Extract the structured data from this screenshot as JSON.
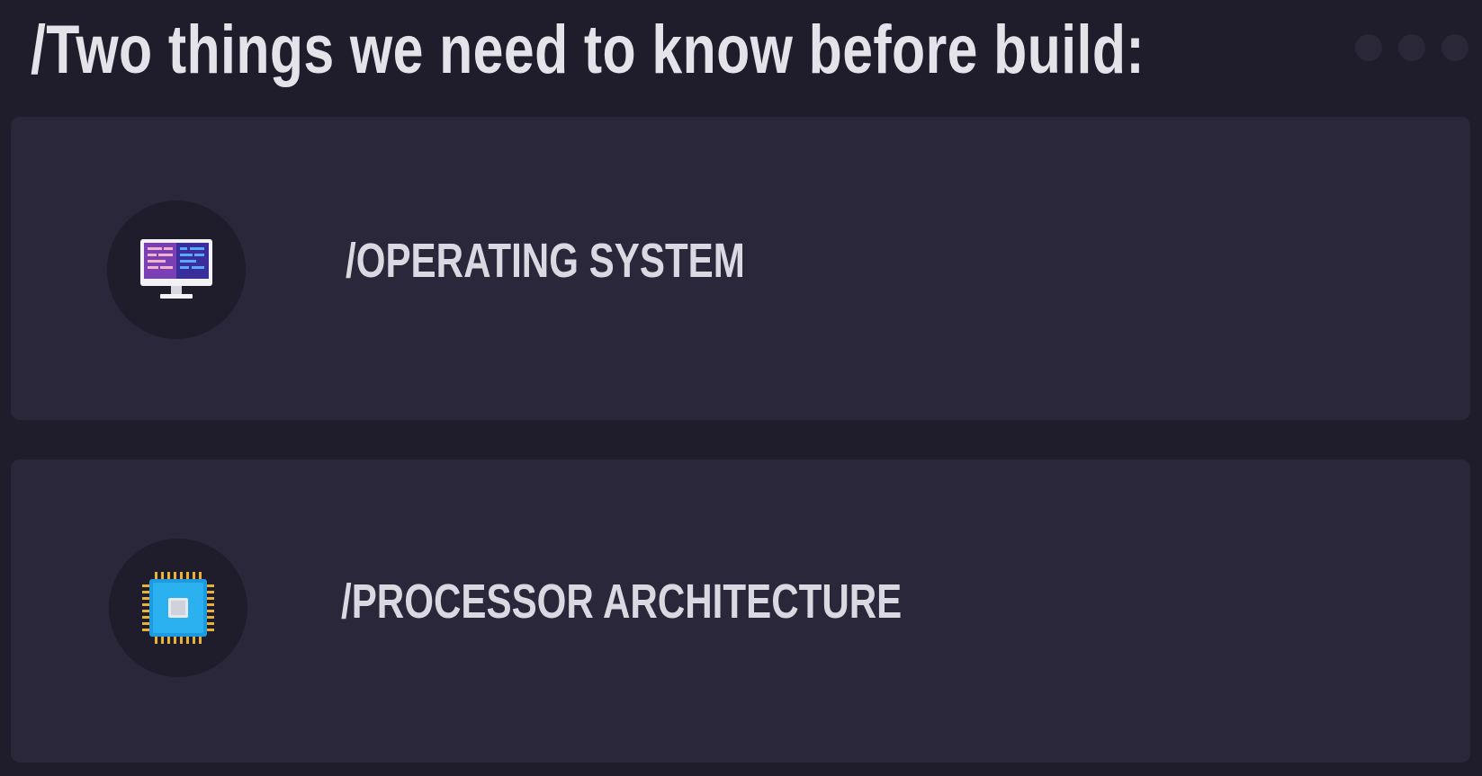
{
  "slide": {
    "title": "/Two things we need to know before build:"
  },
  "items": [
    {
      "label": "/OPERATING SYSTEM",
      "icon": "computer-monitor-icon"
    },
    {
      "label": "/PROCESSOR ARCHITECTURE",
      "icon": "cpu-chip-icon"
    }
  ],
  "colors": {
    "background": "#1f1d2b",
    "card": "#292739",
    "text": "#e4e3ea"
  }
}
